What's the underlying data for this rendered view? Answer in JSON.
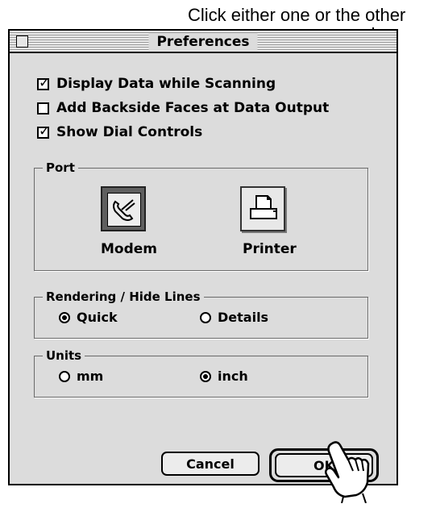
{
  "annotation": {
    "text": "Click either one or the other"
  },
  "window": {
    "title": "Preferences"
  },
  "options": [
    {
      "label": "Display Data while Scanning",
      "checked": true
    },
    {
      "label": "Add Backside Faces at Data Output",
      "checked": false
    },
    {
      "label": "Show Dial Controls",
      "checked": true
    }
  ],
  "port": {
    "label": "Port",
    "modem_label": "Modem",
    "printer_label": "Printer",
    "selected": "Modem",
    "modem_icon": "phone-icon",
    "printer_icon": "printer-icon"
  },
  "rendering": {
    "label": "Rendering / Hide Lines",
    "quick_label": "Quick",
    "details_label": "Details",
    "selected": "Quick"
  },
  "units": {
    "label": "Units",
    "mm_label": "mm",
    "inch_label": "inch",
    "selected": "inch"
  },
  "buttons": {
    "cancel_label": "Cancel",
    "ok_label": "OK"
  },
  "cursor": {
    "icon": "pointing-hand-icon"
  }
}
